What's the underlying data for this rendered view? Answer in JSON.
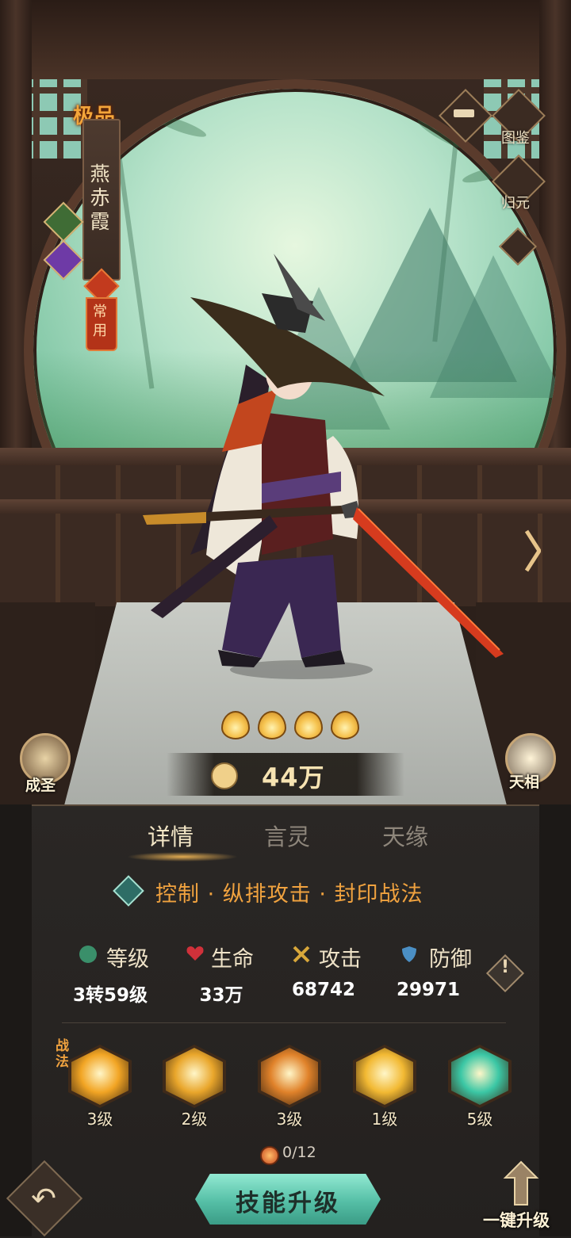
{
  "hero": {
    "quality": "极品",
    "name": "燕赤霞",
    "common_tag": "常用",
    "stars": 4,
    "power": "44万"
  },
  "side_menu": {
    "top_icon": "scroll-icon",
    "archive_label": "图鉴",
    "return_label": "归元",
    "collapse_icon": "chevron-up-icon"
  },
  "corners": {
    "left_label": "成圣",
    "right_label": "天相"
  },
  "tabs": [
    {
      "label": "详情",
      "active": true
    },
    {
      "label": "言灵",
      "active": false
    },
    {
      "label": "天缘",
      "active": false
    }
  ],
  "role_tags": "控制 · 纵排攻击 · 封印战法",
  "stats": [
    {
      "label": "等级",
      "value": "3转59级",
      "icon": "level-icon",
      "color": "#3a8f6a"
    },
    {
      "label": "生命",
      "value": "33万",
      "icon": "heart-icon",
      "color": "#d0313a"
    },
    {
      "label": "攻击",
      "value": "68742",
      "icon": "swords-icon",
      "color": "#d8a73a"
    },
    {
      "label": "防御",
      "value": "29971",
      "icon": "shield-icon",
      "color": "#4b8fc4"
    }
  ],
  "info_mark": "!",
  "skills_section_label": "战法",
  "skills": [
    {
      "level": "3级",
      "icon": "talisman-icon",
      "color": "#f2a524"
    },
    {
      "level": "2级",
      "icon": "sword-slash-icon",
      "color": "#e9a62b"
    },
    {
      "level": "3级",
      "icon": "cards-icon",
      "color": "#e0822a"
    },
    {
      "level": "1级",
      "icon": "yin-yang-icon",
      "color": "#f2b933"
    },
    {
      "level": "5级",
      "icon": "seal-icon",
      "color": "#3bc7a5"
    }
  ],
  "material": {
    "count": "0/12",
    "icon": "orb-icon"
  },
  "buttons": {
    "upgrade": "技能升级",
    "one_click": "一键升级",
    "back_icon": "back-arrow-icon"
  }
}
